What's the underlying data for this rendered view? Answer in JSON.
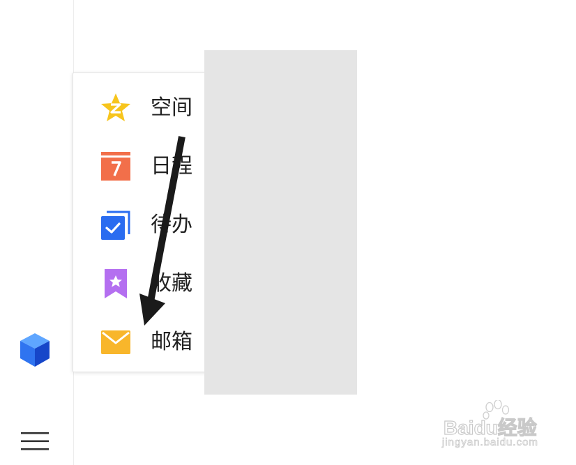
{
  "menu": {
    "items": [
      {
        "label": "空间",
        "icon": "qzone-star-icon",
        "color": "#f7c51d"
      },
      {
        "label": "日程",
        "icon": "calendar-icon",
        "color": "#f26f4a"
      },
      {
        "label": "待办（",
        "icon": "todo-check-icon",
        "color": "#2a6cf0"
      },
      {
        "label": "收藏",
        "icon": "favorite-bookmark-icon",
        "color": "#b46ff0"
      },
      {
        "label": "邮箱（",
        "icon": "mail-icon",
        "color": "#f8b62b"
      }
    ]
  },
  "left_rail": {
    "app_icon": "blue-cube-icon",
    "menu_icon": "hamburger-menu-icon"
  },
  "watermark": {
    "brand": "Baidu经验",
    "url": "jingyan.baidu.com"
  },
  "colors": {
    "overlay_gray": "#e5e5e5",
    "arrow": "#1a1a1a",
    "cube_blue": "#1d63e6"
  }
}
